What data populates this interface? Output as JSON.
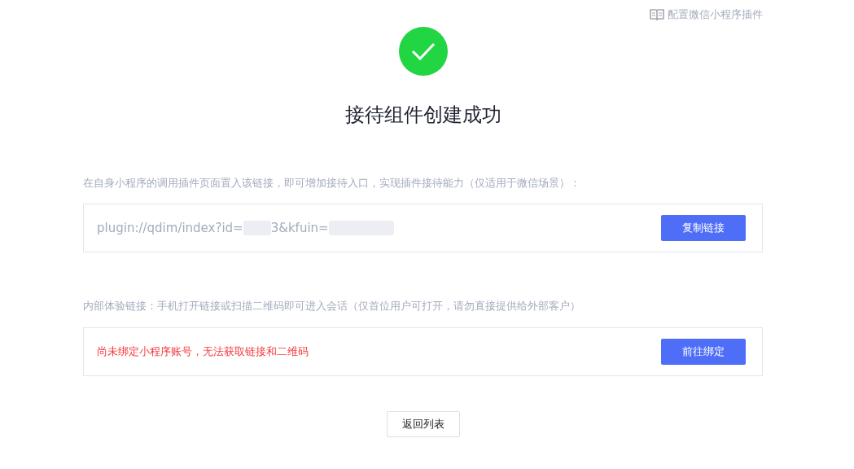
{
  "top_link": {
    "label": "配置微信小程序插件"
  },
  "title": "接待组件创建成功",
  "sections": [
    {
      "description": "在自身小程序的调用插件页面置入该链接，即可增加接待入口，实现插件接待能力（仅适用于微信场景）：",
      "kind": "link",
      "segments": [
        {
          "kind": "text",
          "text": "plugin://qdim/index?id="
        },
        {
          "kind": "blur"
        },
        {
          "kind": "text",
          "text": "3&kfuin="
        },
        {
          "kind": "blur"
        }
      ],
      "button": "复制链接"
    },
    {
      "description": "内部体验链接：手机打开链接或扫描二维码即可进入会话（仅首位用户可打开，请勿直接提供给外部客户）",
      "kind": "error",
      "message": "尚未绑定小程序账号，无法获取链接和二维码",
      "button": "前往绑定"
    }
  ],
  "back_button": "返回列表"
}
